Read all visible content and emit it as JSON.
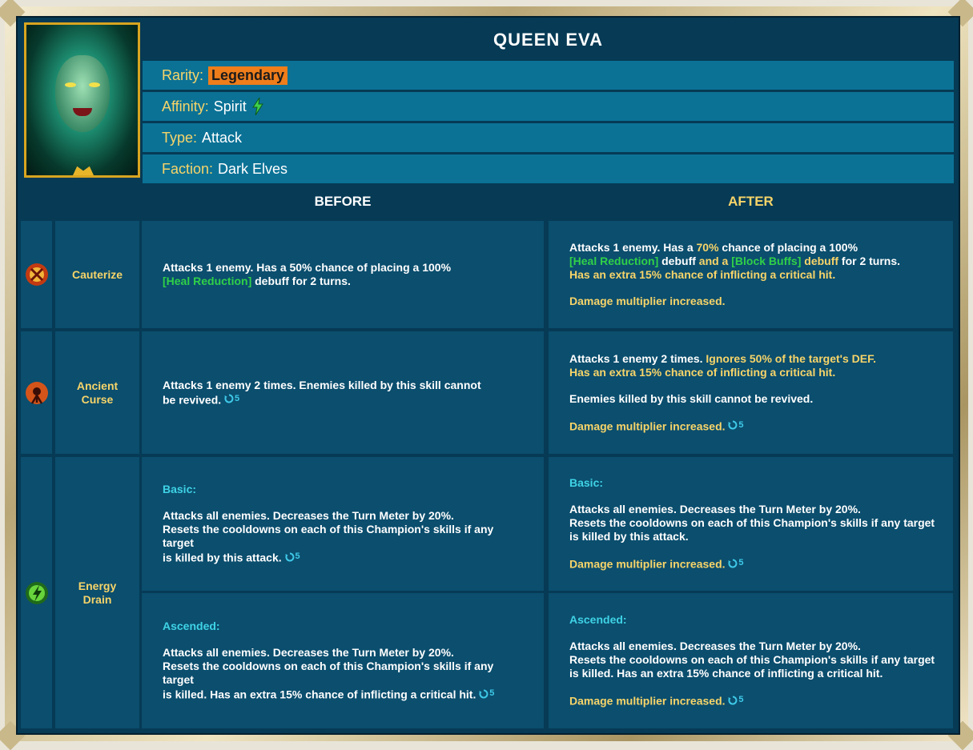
{
  "champion": {
    "name": "QUEEN EVA",
    "rarity_label": "Rarity:",
    "rarity": "Legendary",
    "affinity_label": "Affinity:",
    "affinity": "Spirit",
    "type_label": "Type:",
    "type": "Attack",
    "faction_label": "Faction:",
    "faction": "Dark Elves"
  },
  "table": {
    "before_header": "BEFORE",
    "after_header": "AFTER"
  },
  "skills": [
    {
      "name": "Cauterize",
      "icon": "cauterize-skill-icon",
      "before": {
        "line1": "Attacks 1 enemy. Has a 50% chance of placing a 100%",
        "heal_reduction": "[Heal Reduction]",
        "line2_rest": " debuff for 2 turns."
      },
      "after": {
        "line1_a": "Attacks 1 enemy. Has a ",
        "line1_hl": "70%",
        "line1_b": " chance of placing a 100%",
        "heal_reduction": "[Heal Reduction]",
        "line2_mid": " debuff ",
        "line2_and": "and a ",
        "block_buffs": "[Block Buffs]",
        "line2_debuff": " debuff",
        "line2_end": " for 2 turns.",
        "line3": "Has an extra 15% chance of inflicting a critical hit.",
        "line4": "Damage multiplier increased."
      }
    },
    {
      "name_line1": "Ancient",
      "name_line2": "Curse",
      "icon": "ancient-curse-skill-icon",
      "before": {
        "line1": "Attacks 1 enemy 2 times. Enemies killed by this skill cannot",
        "line2": "be revived.",
        "cooldown": "5"
      },
      "after": {
        "line1_a": "Attacks 1 enemy 2 times. ",
        "line1_hl": "Ignores 50% of the target's DEF.",
        "line2": "Has an extra 15% chance of inflicting a critical hit.",
        "line3": "Enemies killed by this skill cannot be revived.",
        "line4": "Damage multiplier increased.",
        "cooldown": "5"
      }
    },
    {
      "name_line1": "Energy",
      "name_line2": "Drain",
      "icon": "energy-drain-skill-icon",
      "basic_before": {
        "label": "Basic:",
        "line1": "Attacks all enemies. Decreases the Turn Meter by 20%.",
        "line2": "Resets the cooldowns on each of this Champion's skills if any target",
        "line3": "is killed by this attack.",
        "cooldown": "5"
      },
      "basic_after": {
        "label": "Basic:",
        "line1": "Attacks all enemies. Decreases the Turn Meter by 20%.",
        "line2": "Resets the cooldowns on each of this Champion's skills if any target",
        "line3": "is killed by this attack.",
        "line4": "Damage multiplier increased.",
        "cooldown": "5"
      },
      "ascended_before": {
        "label": "Ascended:",
        "line1": "Attacks all enemies. Decreases the Turn Meter by 20%.",
        "line2": "Resets the cooldowns on each of this Champion's skills if any target",
        "line3": "is killed. Has an extra 15% chance of inflicting a critical hit.",
        "cooldown": "5"
      },
      "ascended_after": {
        "label": "Ascended:",
        "line1": "Attacks all enemies. Decreases the Turn Meter by 20%.",
        "line2": "Resets the cooldowns on each of this Champion's skills if any target",
        "line3": "is killed. Has an extra 15% chance of inflicting a critical hit.",
        "line4": "Damage multiplier increased.",
        "cooldown": "5"
      }
    }
  ],
  "colors": {
    "background": "#063a55",
    "cell": "#0b4e6e",
    "info_row": "#0b7296",
    "highlight_yellow": "#f7d469",
    "debuff_green": "#30d048",
    "section_cyan": "#3fd3e6",
    "rarity_orange": "#ef7d1a"
  }
}
